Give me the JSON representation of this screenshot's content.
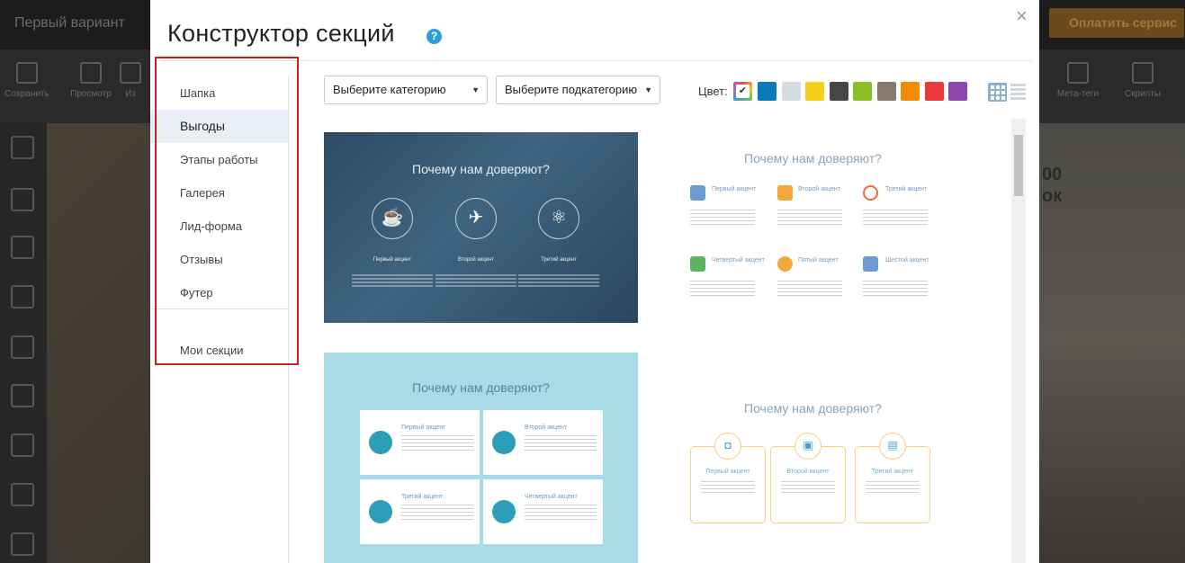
{
  "background": {
    "project_title": "Первый вариант",
    "pay_button": "Оплатить сервис",
    "toolbar": [
      "Сохранить",
      "Просмотр",
      "Из",
      "Мета-теги",
      "Скрипты"
    ],
    "side_partial_text": [
      "00",
      "ок"
    ]
  },
  "modal": {
    "title": "Конструктор секций",
    "help": "?",
    "close": "×",
    "nav": {
      "items": [
        "Шапка",
        "Выгоды",
        "Этапы работы",
        "Галерея",
        "Лид-форма",
        "Отзывы",
        "Футер"
      ],
      "active": "Выгоды",
      "my_sections": "Мои секции"
    },
    "filters": {
      "category_placeholder": "Выберите категорию",
      "subcategory_placeholder": "Выберите подкатегорию",
      "arrow": "▼",
      "color_label": "Цвет:",
      "colors": [
        "#0a7bb8",
        "#d5dde0",
        "#f5d11b",
        "#474747",
        "#8cbf26",
        "#8a7a6e",
        "#f58a07",
        "#e83a3a",
        "#8e44ad"
      ]
    },
    "templates": [
      {
        "heading": "Почему нам доверяют?",
        "items": [
          "Первый акцент",
          "Второй акцент",
          "Третий акцент"
        ]
      },
      {
        "heading": "Почему нам доверяют?",
        "items": [
          "Первый акцент",
          "Второй акцент",
          "Третий акцент",
          "Четвертый акцент",
          "Пятый акцент",
          "Шестой акцент"
        ]
      },
      {
        "heading": "Почему нам доверяют?",
        "items": [
          "Первый акцент",
          "Второй акцент",
          "Третий акцент",
          "Четвертый акцент"
        ]
      },
      {
        "heading": "Почему нам доверяют?",
        "items": [
          "Первый акцент",
          "Второй акцент",
          "Третий акцент"
        ]
      }
    ]
  }
}
